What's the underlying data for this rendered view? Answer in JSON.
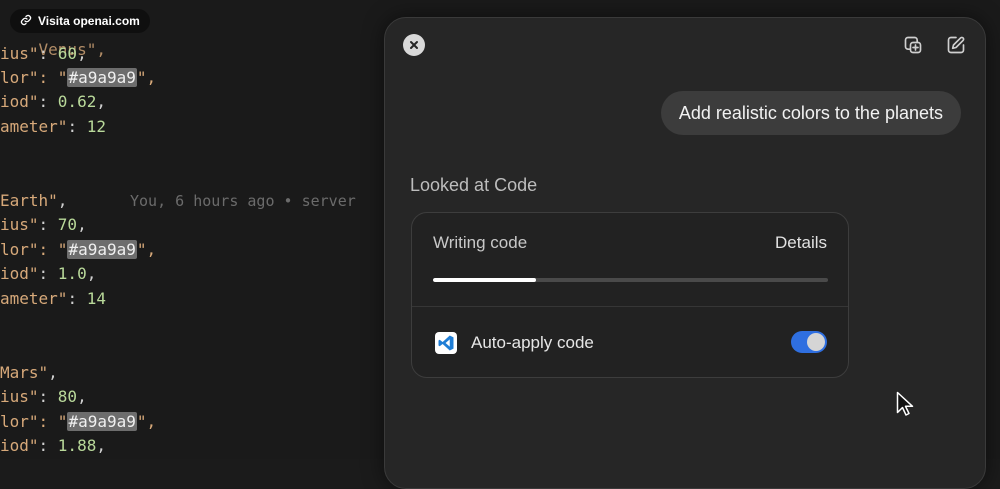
{
  "visit_badge": {
    "label": "Visita openai.com",
    "icon": "link-icon"
  },
  "editor": {
    "blame": "You, 6 hours ago • server",
    "lines": [
      {
        "key": "Venus\",",
        "partial": true
      },
      {
        "key": "ius\"",
        "sep": ": ",
        "value": "60",
        "trail": ","
      },
      {
        "key": "lor\"",
        "sep": ": \"",
        "value": "#a9a9a9",
        "trail": "\","
      },
      {
        "key": "iod\"",
        "sep": ": ",
        "value": "0.62",
        "trail": ","
      },
      {
        "key": "ameter\"",
        "sep": ": ",
        "value": "12",
        "trail": ""
      },
      {
        "key": "Earth\"",
        "trail": ","
      },
      {
        "key": "ius\"",
        "sep": ": ",
        "value": "70",
        "trail": ","
      },
      {
        "key": "lor\"",
        "sep": ": \"",
        "value": "#a9a9a9",
        "trail": "\","
      },
      {
        "key": "iod\"",
        "sep": ": ",
        "value": "1.0",
        "trail": ","
      },
      {
        "key": "ameter\"",
        "sep": ": ",
        "value": "14",
        "trail": ""
      },
      {
        "key": "Mars\"",
        "trail": ","
      },
      {
        "key": "ius\"",
        "sep": ": ",
        "value": "80",
        "trail": ","
      },
      {
        "key": "lor\"",
        "sep": ": \"",
        "value": "#a9a9a9",
        "trail": "\","
      },
      {
        "key": "iod\"",
        "sep": ": ",
        "value": "1.88",
        "trail": ","
      }
    ]
  },
  "panel": {
    "close_icon": "close-icon",
    "tool_icons": [
      "copy-window-icon",
      "edit-icon"
    ],
    "user_message": "Add realistic colors to the planets",
    "looked_label": "Looked at Code",
    "card": {
      "title": "Writing code",
      "details_label": "Details",
      "progress": 0.26,
      "app_icon": "vscode-icon",
      "auto_apply_label": "Auto-apply code",
      "auto_apply_on": true
    }
  },
  "colors": {
    "accent": "#2f6fe0",
    "panel_bg": "#262626",
    "bubble_bg": "#3c3c3c"
  }
}
